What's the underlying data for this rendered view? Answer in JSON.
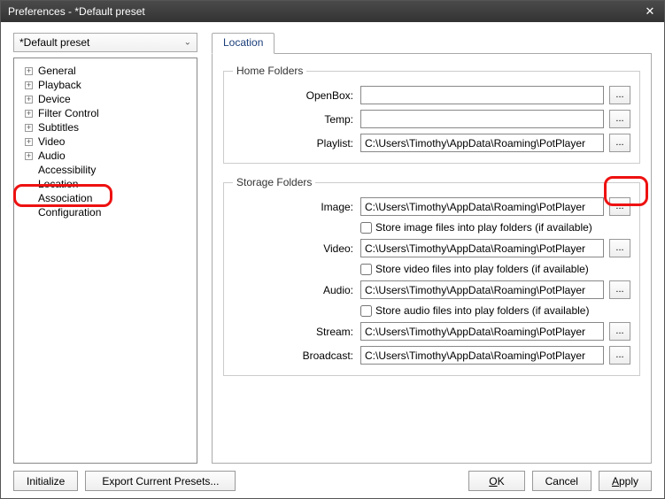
{
  "window": {
    "title": "Preferences - *Default preset"
  },
  "preset": {
    "selected": "*Default preset"
  },
  "tree": {
    "items": [
      {
        "label": "General",
        "expandable": true
      },
      {
        "label": "Playback",
        "expandable": true
      },
      {
        "label": "Device",
        "expandable": true
      },
      {
        "label": "Filter Control",
        "expandable": true
      },
      {
        "label": "Subtitles",
        "expandable": true
      },
      {
        "label": "Video",
        "expandable": true
      },
      {
        "label": "Audio",
        "expandable": true
      },
      {
        "label": "Accessibility",
        "expandable": false
      },
      {
        "label": "Location",
        "expandable": false
      },
      {
        "label": "Association",
        "expandable": false
      },
      {
        "label": "Configuration",
        "expandable": false
      }
    ]
  },
  "tab": {
    "label": "Location"
  },
  "home": {
    "legend": "Home Folders",
    "openbox_label": "OpenBox:",
    "openbox_value": "",
    "temp_label": "Temp:",
    "temp_value": "",
    "playlist_label": "Playlist:",
    "playlist_value": "C:\\Users\\Timothy\\AppData\\Roaming\\PotPlayer"
  },
  "storage": {
    "legend": "Storage Folders",
    "image_label": "Image:",
    "image_value": "C:\\Users\\Timothy\\AppData\\Roaming\\PotPlayer",
    "image_chk": "Store image files into play folders (if available)",
    "video_label": "Video:",
    "video_value": "C:\\Users\\Timothy\\AppData\\Roaming\\PotPlayer",
    "video_chk": "Store video files into play folders (if available)",
    "audio_label": "Audio:",
    "audio_value": "C:\\Users\\Timothy\\AppData\\Roaming\\PotPlayer",
    "audio_chk": "Store audio files into play folders (if available)",
    "stream_label": "Stream:",
    "stream_value": "C:\\Users\\Timothy\\AppData\\Roaming\\PotPlayer",
    "broadcast_label": "Broadcast:",
    "broadcast_value": "C:\\Users\\Timothy\\AppData\\Roaming\\PotPlayer"
  },
  "browse_label": "...",
  "buttons": {
    "initialize": "Initialize",
    "export": "Export Current Presets...",
    "ok": "OK",
    "cancel": "Cancel",
    "apply": "Apply"
  }
}
